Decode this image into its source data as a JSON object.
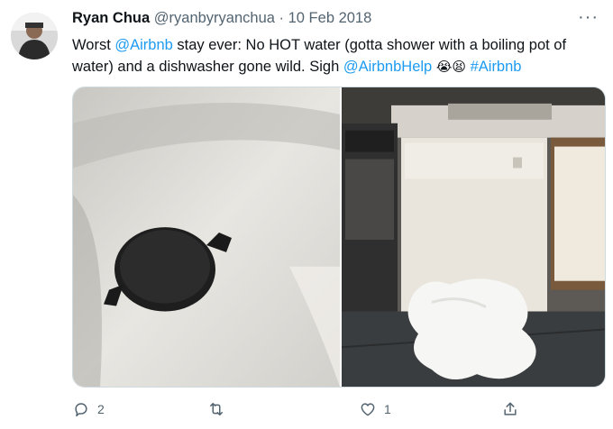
{
  "tweet": {
    "author_name": "Ryan Chua",
    "handle": "@ryanbyryanchua",
    "separator": "·",
    "date": "10 Feb 2018",
    "more_label": "···",
    "text": {
      "part1": "Worst ",
      "mention1": "@Airbnb",
      "part2": " stay ever: No HOT water (gotta shower with a boiling pot of water) and a dishwasher gone wild. Sigh ",
      "mention2": "@AirbnbHelp",
      "emojis": "😭😫",
      "hashtag": "#Airbnb"
    },
    "replies": "2",
    "retweets": "",
    "likes": "1"
  },
  "colors": {
    "link": "#1d9bf0",
    "muted": "#536471",
    "text": "#0f1419",
    "border": "#cfd9de"
  },
  "icons": [
    "more-icon",
    "reply-icon",
    "retweet-icon",
    "like-icon",
    "share-icon"
  ]
}
